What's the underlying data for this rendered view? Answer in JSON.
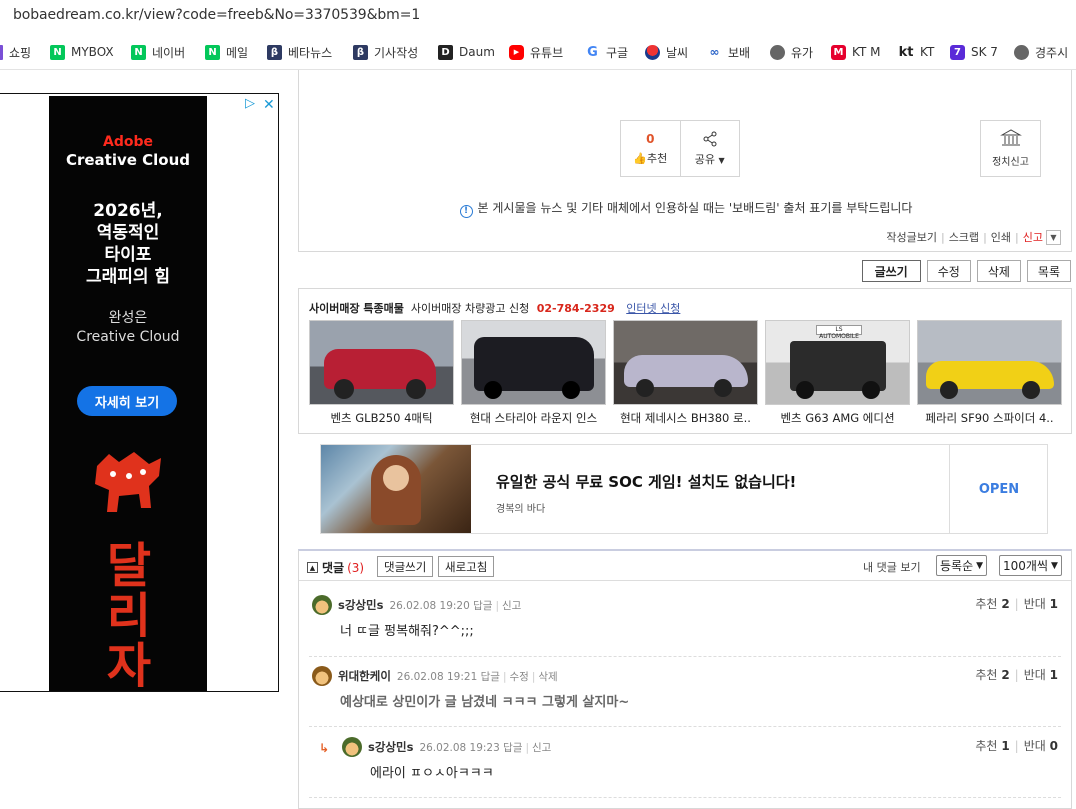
{
  "browser": {
    "url": "bobaedream.co.kr/view?code=freeb&No=3370539&bm=1"
  },
  "bookmarks": [
    {
      "label": "쇼핑",
      "icon": "shopping-icon"
    },
    {
      "label": "MYBOX",
      "icon": "naver-n-icon"
    },
    {
      "label": "네이버",
      "icon": "naver-n-icon"
    },
    {
      "label": "메일",
      "icon": "naver-n-icon"
    },
    {
      "label": "베타뉴스",
      "icon": "beta-news-icon"
    },
    {
      "label": "기사작성",
      "icon": "beta-news-icon"
    },
    {
      "label": "Daum",
      "icon": "daum-icon"
    },
    {
      "label": "유튜브",
      "icon": "youtube-icon"
    },
    {
      "label": "구글",
      "icon": "google-icon"
    },
    {
      "label": "날씨",
      "icon": "weather-icon"
    },
    {
      "label": "보배",
      "icon": "bobae-icon"
    },
    {
      "label": "유가",
      "icon": "globe-icon"
    },
    {
      "label": "KT M",
      "icon": "m-icon"
    },
    {
      "label": "KT",
      "icon": "kt-icon"
    },
    {
      "label": "SK 7",
      "icon": "sk7-icon"
    },
    {
      "label": "경주시",
      "icon": "globe-icon"
    }
  ],
  "left_ad": {
    "brand": "Adobe",
    "product": "Creative Cloud",
    "headline_lines": [
      "2026년,",
      "역동적인",
      "타이포",
      "그래피의 힘"
    ],
    "sub_lines": [
      "완성은",
      "Creative Cloud"
    ],
    "cta": "자세히 보기",
    "art_text": "달리자"
  },
  "post": {
    "recommend_count": "0",
    "recommend_label": "추천",
    "share_label": "공유",
    "report_label": "정치신고",
    "notice": "본 게시물을 뉴스 및 기타 매체에서 인용하실 때는 '보배드림' 출처 표기를 부탁드립니다",
    "links": [
      "작성글보기",
      "스크랩",
      "인쇄"
    ],
    "report_link": "신고"
  },
  "actions": [
    "글쓰기",
    "수정",
    "삭제",
    "목록"
  ],
  "cyber": {
    "title": "사이버매장 특종매물",
    "sub": "사이버매장 차량광고 신청",
    "phone": "02-784-2329",
    "link": "인터넷 신청",
    "cars": [
      {
        "caption": "벤츠 GLB250 4매틱",
        "color": "#c8243a"
      },
      {
        "caption": "현대 스타리아 라운지 인스",
        "color": "#2a2a2e"
      },
      {
        "caption": "현대 제네시스 BH380 로..",
        "color": "#b8b4c6"
      },
      {
        "caption": "벤츠 G63 AMG 에디션",
        "color": "#333333"
      },
      {
        "caption": "페라리 SF90 스파이더 4..",
        "color": "#f2d31a"
      }
    ]
  },
  "game_ad": {
    "title": "유일한 공식 무료 SOC 게임! 설치도 없습니다!",
    "brand": "경복의 바다",
    "cta": "OPEN"
  },
  "comments": {
    "label": "댓글",
    "count": "(3)",
    "write_btn": "댓글쓰기",
    "refresh_btn": "새로고침",
    "my_comments": "내 댓글 보기",
    "sort": "등록순",
    "per_page": "100개씩",
    "items": [
      {
        "nick": "s강상민s",
        "date": "26.02.08 19:20",
        "meta": [
          "답글",
          "신고"
        ],
        "body": "너 ㄸ글 펑복해줘?^^;;;",
        "up": "2",
        "down": "1",
        "up_label": "추천",
        "down_label": "반대"
      },
      {
        "nick": "위대한케이",
        "date": "26.02.08 19:21",
        "meta": [
          "답글",
          "수정",
          "삭제"
        ],
        "body": "예상대로 상민이가 글 남겼네 ㅋㅋㅋ 그렇게 살지마~",
        "up": "2",
        "down": "1",
        "up_label": "추천",
        "down_label": "반대"
      },
      {
        "nick": "s강상민s",
        "date": "26.02.08 19:23",
        "meta": [
          "답글",
          "신고"
        ],
        "body": "에라이 ㅍㅇㅅ아ㅋㅋㅋ",
        "up": "1",
        "down": "0",
        "up_label": "추천",
        "down_label": "반대"
      }
    ]
  }
}
